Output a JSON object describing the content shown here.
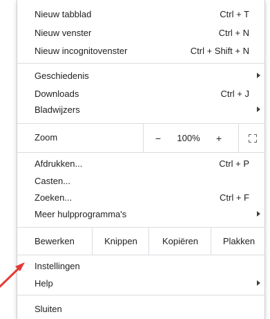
{
  "menu": {
    "group1": [
      {
        "label": "Nieuw tabblad",
        "shortcut": "Ctrl + T"
      },
      {
        "label": "Nieuw venster",
        "shortcut": "Ctrl + N"
      },
      {
        "label": "Nieuw incognitovenster",
        "shortcut": "Ctrl + Shift + N"
      }
    ],
    "group2": [
      {
        "label": "Geschiedenis",
        "shortcut": ""
      },
      {
        "label": "Downloads",
        "shortcut": "Ctrl + J"
      },
      {
        "label": "Bladwijzers",
        "shortcut": ""
      }
    ],
    "zoom": {
      "label": "Zoom",
      "minus": "−",
      "value": "100%",
      "plus": "+",
      "fullscreen_icon": "fullscreen-icon"
    },
    "group3": [
      {
        "label": "Afdrukken...",
        "shortcut": "Ctrl + P"
      },
      {
        "label": "Casten...",
        "shortcut": ""
      },
      {
        "label": "Zoeken...",
        "shortcut": "Ctrl + F"
      },
      {
        "label": "Meer hulpprogramma's",
        "shortcut": ""
      }
    ],
    "edit": {
      "label": "Bewerken",
      "cut": "Knippen",
      "copy": "Kopiëren",
      "paste": "Plakken"
    },
    "group4": [
      {
        "label": "Instellingen",
        "shortcut": ""
      },
      {
        "label": "Help",
        "shortcut": ""
      }
    ],
    "group5": [
      {
        "label": "Sluiten",
        "shortcut": ""
      }
    ]
  },
  "colors": {
    "annotation_arrow": "#e53935"
  }
}
